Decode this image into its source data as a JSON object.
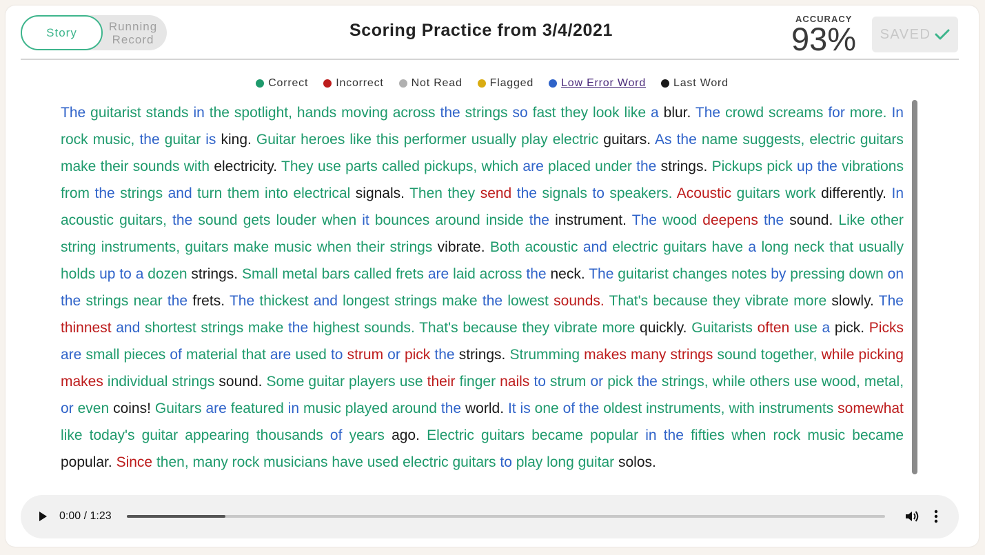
{
  "toggle": {
    "story_label": "Story",
    "running_record_label": "Running\nRecord"
  },
  "title": "Scoring Practice from 3/4/2021",
  "accuracy": {
    "label": "ACCURACY",
    "value": "93%"
  },
  "save_button": {
    "label": "SAVED"
  },
  "colors": {
    "correct": "#1e9a6c",
    "incorrect": "#bd1c1c",
    "not_read": "#b0b0b0",
    "flagged": "#d9ac12",
    "low_error": "#2f63c9",
    "last": "#1a1a1a",
    "accent": "#3db58c"
  },
  "legend": [
    {
      "label": "Correct",
      "color": "#1e9a6c"
    },
    {
      "label": "Incorrect",
      "color": "#bd1c1c"
    },
    {
      "label": "Not Read",
      "color": "#b0b0b0"
    },
    {
      "label": "Flagged",
      "color": "#d9ac12"
    },
    {
      "label": "Low Error Word",
      "color": "#2f63c9",
      "link": true
    },
    {
      "label": "Last Word",
      "color": "#1a1a1a"
    }
  ],
  "story_segments": [
    [
      "l",
      "The"
    ],
    [
      "c",
      "guitarist stands"
    ],
    [
      "l",
      "in"
    ],
    [
      "c",
      "the spotlight, hands moving across"
    ],
    [
      "l",
      "the"
    ],
    [
      "c",
      "strings"
    ],
    [
      "l",
      "so"
    ],
    [
      "c",
      "fast they look like"
    ],
    [
      "l",
      "a"
    ],
    [
      "p",
      "blur."
    ],
    [
      "l",
      "The"
    ],
    [
      "c",
      "crowd screams"
    ],
    [
      "l",
      "for"
    ],
    [
      "c",
      "more."
    ],
    [
      "l",
      "In"
    ],
    [
      "c",
      "rock music,"
    ],
    [
      "l",
      "the"
    ],
    [
      "c",
      "guitar"
    ],
    [
      "l",
      "is"
    ],
    [
      "p",
      "king."
    ],
    [
      "c",
      "Guitar heroes like this performer usually play electric"
    ],
    [
      "p",
      "guitars."
    ],
    [
      "l",
      "As the"
    ],
    [
      "c",
      "name suggests, electric guitars make their sounds with"
    ],
    [
      "p",
      "electricity."
    ],
    [
      "c",
      "They use parts called pickups, which"
    ],
    [
      "l",
      "are"
    ],
    [
      "c",
      "placed under"
    ],
    [
      "l",
      "the"
    ],
    [
      "p",
      "strings."
    ],
    [
      "c",
      "Pickups pick"
    ],
    [
      "l",
      "up the"
    ],
    [
      "c",
      "vibrations from"
    ],
    [
      "l",
      "the"
    ],
    [
      "c",
      "strings"
    ],
    [
      "l",
      "and"
    ],
    [
      "c",
      "turn them into electrical"
    ],
    [
      "p",
      "signals."
    ],
    [
      "c",
      "Then they"
    ],
    [
      "i",
      "send"
    ],
    [
      "l",
      "the"
    ],
    [
      "c",
      "signals"
    ],
    [
      "l",
      "to"
    ],
    [
      "c",
      "speakers."
    ],
    [
      "i",
      "Acoustic"
    ],
    [
      "c",
      "guitars work"
    ],
    [
      "p",
      "differently."
    ],
    [
      "l",
      "In"
    ],
    [
      "c",
      "acoustic guitars,"
    ],
    [
      "l",
      "the"
    ],
    [
      "c",
      "sound gets louder when"
    ],
    [
      "l",
      "it"
    ],
    [
      "c",
      "bounces around inside"
    ],
    [
      "l",
      "the"
    ],
    [
      "p",
      "instrument."
    ],
    [
      "l",
      "The"
    ],
    [
      "c",
      "wood"
    ],
    [
      "i",
      "deepens"
    ],
    [
      "l",
      "the"
    ],
    [
      "p",
      "sound."
    ],
    [
      "c",
      "Like other string instruments, guitars make music when their strings"
    ],
    [
      "p",
      "vibrate."
    ],
    [
      "c",
      "Both acoustic"
    ],
    [
      "l",
      "and"
    ],
    [
      "c",
      "electric guitars have"
    ],
    [
      "l",
      "a"
    ],
    [
      "c",
      "long neck that usually holds"
    ],
    [
      "l",
      "up to a"
    ],
    [
      "c",
      "dozen"
    ],
    [
      "p",
      "strings."
    ],
    [
      "c",
      "Small metal bars called frets"
    ],
    [
      "l",
      "are"
    ],
    [
      "c",
      "laid across"
    ],
    [
      "l",
      "the"
    ],
    [
      "p",
      "neck."
    ],
    [
      "l",
      "The"
    ],
    [
      "c",
      "guitarist changes notes"
    ],
    [
      "l",
      "by"
    ],
    [
      "c",
      "pressing down"
    ],
    [
      "l",
      "on the"
    ],
    [
      "c",
      "strings near"
    ],
    [
      "l",
      "the"
    ],
    [
      "p",
      "frets."
    ],
    [
      "l",
      "The"
    ],
    [
      "c",
      "thickest"
    ],
    [
      "l",
      "and"
    ],
    [
      "c",
      "longest strings make"
    ],
    [
      "l",
      "the"
    ],
    [
      "c",
      "lowest"
    ],
    [
      "i",
      "sounds."
    ],
    [
      "c",
      "That's because they vibrate more"
    ],
    [
      "p",
      "slowly."
    ],
    [
      "l",
      "The"
    ],
    [
      "i",
      "thinnest"
    ],
    [
      "l",
      "and"
    ],
    [
      "c",
      "shortest strings make"
    ],
    [
      "l",
      "the"
    ],
    [
      "c",
      "highest sounds. That's because they vibrate more"
    ],
    [
      "p",
      "quickly."
    ],
    [
      "c",
      "Guitarists"
    ],
    [
      "i",
      "often"
    ],
    [
      "c",
      "use"
    ],
    [
      "l",
      "a"
    ],
    [
      "p",
      "pick."
    ],
    [
      "i",
      "Picks"
    ],
    [
      "l",
      "are"
    ],
    [
      "c",
      "small pieces"
    ],
    [
      "l",
      "of"
    ],
    [
      "c",
      "material that"
    ],
    [
      "l",
      "are"
    ],
    [
      "c",
      "used"
    ],
    [
      "l",
      "to"
    ],
    [
      "i",
      "strum"
    ],
    [
      "l",
      "or"
    ],
    [
      "i",
      "pick"
    ],
    [
      "l",
      "the"
    ],
    [
      "p",
      "strings."
    ],
    [
      "c",
      "Strumming"
    ],
    [
      "i",
      "makes many strings"
    ],
    [
      "c",
      "sound together,"
    ],
    [
      "i",
      "while picking makes"
    ],
    [
      "c",
      "individual strings"
    ],
    [
      "p",
      "sound."
    ],
    [
      "c",
      "Some guitar players use"
    ],
    [
      "i",
      "their"
    ],
    [
      "c",
      "finger"
    ],
    [
      "i",
      "nails"
    ],
    [
      "l",
      "to"
    ],
    [
      "c",
      "strum"
    ],
    [
      "l",
      "or"
    ],
    [
      "c",
      "pick"
    ],
    [
      "l",
      "the"
    ],
    [
      "c",
      "strings, while others use wood, metal,"
    ],
    [
      "l",
      "or"
    ],
    [
      "c",
      "even"
    ],
    [
      "p",
      "coins!"
    ],
    [
      "c",
      "Guitars"
    ],
    [
      "l",
      "are"
    ],
    [
      "c",
      "featured"
    ],
    [
      "l",
      "in"
    ],
    [
      "c",
      "music played around"
    ],
    [
      "l",
      "the"
    ],
    [
      "p",
      "world."
    ],
    [
      "l",
      "It is"
    ],
    [
      "c",
      "one"
    ],
    [
      "l",
      "of the"
    ],
    [
      "c",
      "oldest instruments, with instruments"
    ],
    [
      "i",
      "somewhat"
    ],
    [
      "c",
      "like today's guitar appearing thousands"
    ],
    [
      "l",
      "of"
    ],
    [
      "c",
      "years"
    ],
    [
      "p",
      "ago."
    ],
    [
      "c",
      "Electric guitars became popular"
    ],
    [
      "l",
      "in the"
    ],
    [
      "c",
      "fifties when rock music became"
    ],
    [
      "p",
      "popular."
    ],
    [
      "i",
      "Since"
    ],
    [
      "c",
      "then, many rock musicians have used electric guitars"
    ],
    [
      "l",
      "to"
    ],
    [
      "c",
      "play long guitar"
    ],
    [
      "p",
      "solos."
    ]
  ],
  "player": {
    "time": "0:00 / 1:23",
    "progress": 0.13
  }
}
